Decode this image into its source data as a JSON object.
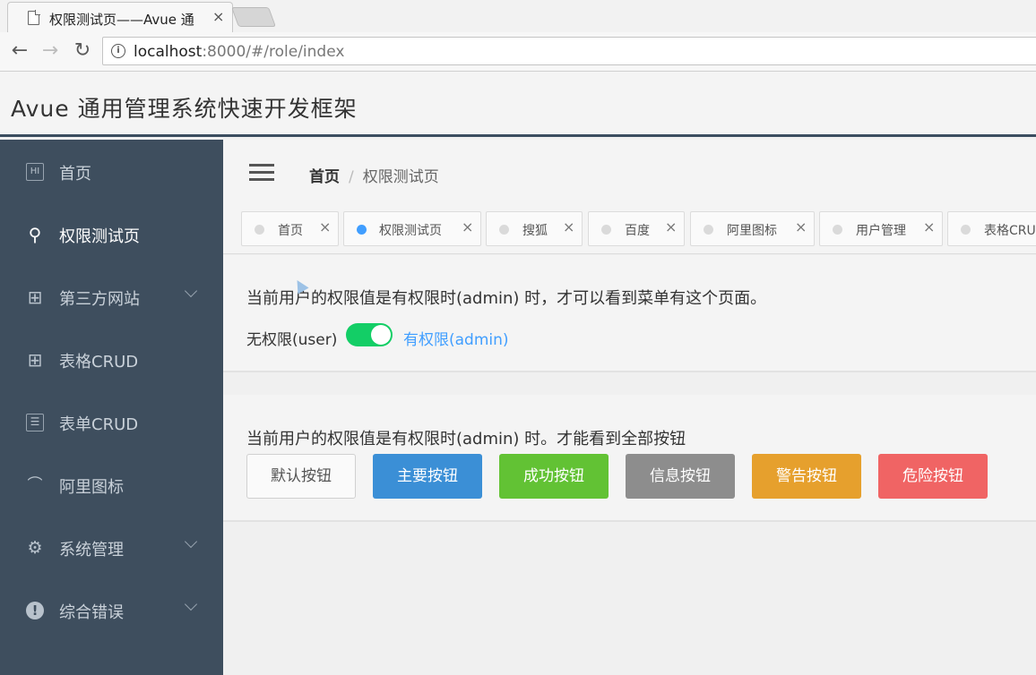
{
  "browser": {
    "tab_title": "权限测试页——Avue 通",
    "tab_close": "×",
    "url_host": "localhost",
    "url_path": ":8000/#/role/index",
    "back": "←",
    "forward": "→",
    "reload": "↻"
  },
  "app": {
    "title": "Avue 通用管理系统快速开发框架"
  },
  "sidebar": {
    "items": [
      {
        "label": "首页",
        "icon": "home-icon",
        "glyph": "HI"
      },
      {
        "label": "权限测试页",
        "icon": "key-icon",
        "glyph": "⚲",
        "active": true
      },
      {
        "label": "第三方网站",
        "icon": "grid-icon",
        "glyph": "⊞",
        "has_children": true
      },
      {
        "label": "表格CRUD",
        "icon": "table-icon",
        "glyph": "⊞"
      },
      {
        "label": "表单CRUD",
        "icon": "form-icon",
        "glyph": "☰"
      },
      {
        "label": "阿里图标",
        "icon": "speedometer-icon",
        "glyph": "⌒"
      },
      {
        "label": "系统管理",
        "icon": "gear-icon",
        "glyph": "⚙",
        "has_children": true
      },
      {
        "label": "综合错误",
        "icon": "alert-icon",
        "glyph": "!",
        "has_children": true
      }
    ]
  },
  "breadcrumb": {
    "home": "首页",
    "separator": "/",
    "current": "权限测试页"
  },
  "tags": [
    {
      "label": "首页",
      "active": false
    },
    {
      "label": "权限测试页",
      "active": true
    },
    {
      "label": "搜狐",
      "active": false
    },
    {
      "label": "百度",
      "active": false
    },
    {
      "label": "阿里图标",
      "active": false
    },
    {
      "label": "用户管理",
      "active": false
    },
    {
      "label": "表格CRUD",
      "active": false
    }
  ],
  "tag_close": "×",
  "section1": {
    "message": "当前用户的权限值是有权限时(admin) 时，才可以看到菜单有这个页面。",
    "switch_off_label": "无权限(user)",
    "switch_on_label": "有权限(admin)",
    "switch_on": true
  },
  "section2": {
    "message": "当前用户的权限值是有权限时(admin) 时。才能看到全部按钮",
    "buttons": [
      {
        "label": "默认按钮",
        "type": "default",
        "color": "#fafafa"
      },
      {
        "label": "主要按钮",
        "type": "primary",
        "color": "#3b8fd6"
      },
      {
        "label": "成功按钮",
        "type": "success",
        "color": "#62c234"
      },
      {
        "label": "信息按钮",
        "type": "info",
        "color": "#8d8d8d"
      },
      {
        "label": "警告按钮",
        "type": "warning",
        "color": "#e6a02d"
      },
      {
        "label": "危险按钮",
        "type": "danger",
        "color": "#f06464"
      }
    ]
  }
}
